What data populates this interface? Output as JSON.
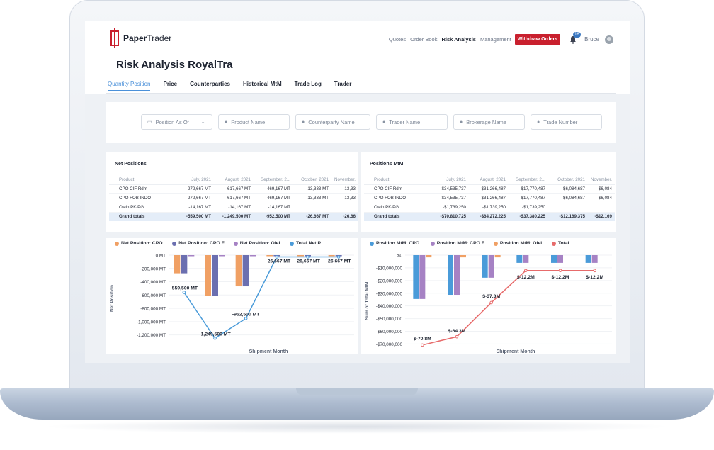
{
  "app": {
    "logo_bold": "Paper",
    "logo_rest": "Trader"
  },
  "nav": {
    "items": [
      "Quotes",
      "Order Book",
      "Risk Analysis",
      "Management"
    ],
    "active": "Risk Analysis",
    "withdraw": "Withdraw Orders",
    "notifications": "16",
    "user": "Bruce"
  },
  "page": {
    "title": "Risk Analysis RoyalTra"
  },
  "tabs": [
    "Quantity Position",
    "Price",
    "Counterparties",
    "Historical MtM",
    "Trade Log",
    "Trader"
  ],
  "filters": {
    "position_as_of": "Position As Of",
    "product": "Product Name",
    "counterparty": "Counterparty Name",
    "trader": "Trader Name",
    "brokerage": "Brokerage Name",
    "trade_number": "Trade Number"
  },
  "net_positions": {
    "title": "Net Positions",
    "columns": [
      "Product",
      "July, 2021",
      "August, 2021",
      "September, 2...",
      "October, 2021",
      "November,"
    ],
    "rows": [
      [
        "CPO CIF Rdm",
        "-272,667 MT",
        "-617,667 MT",
        "-469,167 MT",
        "-13,333 MT",
        "-13,33"
      ],
      [
        "CPO FOB INDO",
        "-272,667 MT",
        "-617,667 MT",
        "-469,167 MT",
        "-13,333 MT",
        "-13,33"
      ],
      [
        "Olein PK/PG",
        "-14,167 MT",
        "-14,167 MT",
        "-14,167 MT",
        "",
        ""
      ]
    ],
    "total": [
      "Grand totals",
      "-559,500 MT",
      "-1,249,500 MT",
      "-952,500 MT",
      "-26,667 MT",
      "-26,66"
    ]
  },
  "positions_mtm": {
    "title": "Positions MtM",
    "columns": [
      "Product",
      "July, 2021",
      "August, 2021",
      "September, 2...",
      "October, 2021",
      "November,"
    ],
    "rows": [
      [
        "CPO CIF Rdm",
        "-$34,535,737",
        "-$31,266,487",
        "-$17,770,487",
        "-$6,084,687",
        "-$6,084"
      ],
      [
        "CPO FOB INDO",
        "-$34,535,737",
        "-$31,266,487",
        "-$17,770,487",
        "-$6,084,687",
        "-$6,084"
      ],
      [
        "Olein PK/PG",
        "-$1,739,250",
        "-$1,739,250",
        "-$1,739,250",
        "",
        ""
      ]
    ],
    "total": [
      "Grand totals",
      "-$70,810,725",
      "-$64,272,225",
      "-$37,380,225",
      "-$12,169,375",
      "-$12,169"
    ]
  },
  "chart_data": [
    {
      "type": "bar",
      "legend": [
        "Net Position: CPO...",
        "Net Position: CPO F...",
        "Net Position: Olei...",
        "Total Net P..."
      ],
      "ylabel": "Net Position",
      "xlabel": "Shipment Month",
      "yticks": [
        "0 MT",
        "-200,000 MT",
        "-400,000 MT",
        "-600,000 MT",
        "-800,000 MT",
        "-1,000,000 MT",
        "-1,200,000 MT"
      ],
      "ylim": [
        -1300000,
        0
      ],
      "series": [
        {
          "name": "Net Position: CPO...",
          "color": "#f0a064",
          "values": [
            -272667,
            -617667,
            -469167,
            -13333,
            -13333,
            -13333
          ]
        },
        {
          "name": "Net Position: CPO F...",
          "color": "#6b6fb0",
          "values": [
            -272667,
            -617667,
            -469167,
            -13333,
            -13333,
            -13333
          ]
        },
        {
          "name": "Net Position: Olei...",
          "color": "#a682c4",
          "values": [
            -14167,
            -14167,
            -14167,
            0,
            0,
            0
          ]
        },
        {
          "name": "Total Net P...",
          "color": "#4a9bd9",
          "values": [
            -559500,
            -1249500,
            -952500,
            -26667,
            -26667,
            -26667
          ]
        }
      ],
      "labels": [
        "-559,500 MT",
        "-1,249,500 MT",
        "-952,500 MT",
        "-26,667 MT",
        "-26,667 MT",
        "-26,667 MT"
      ]
    },
    {
      "type": "bar",
      "legend": [
        "Position MtM: CPO ...",
        "Position MtM: CPO F...",
        "Position MtM: Olei...",
        "Total ..."
      ],
      "ylabel": "Sum of Total MtM",
      "xlabel": "Shipment Month",
      "yticks": [
        "$0",
        "-$10,000,000",
        "-$20,000,000",
        "-$30,000,000",
        "-$40,000,000",
        "-$50,000,000",
        "-$60,000,000",
        "-$70,000,000"
      ],
      "ylim": [
        -72000000,
        0
      ],
      "series": [
        {
          "name": "Position MtM: CPO ...",
          "color": "#4a9bd9",
          "values": [
            -34535737,
            -31266487,
            -17770487,
            -6084687,
            -6084687,
            -6084687
          ]
        },
        {
          "name": "Position MtM: CPO F...",
          "color": "#a682c4",
          "values": [
            -34535737,
            -31266487,
            -17770487,
            -6084687,
            -6084687,
            -6084687
          ]
        },
        {
          "name": "Position MtM: Olei...",
          "color": "#f0a064",
          "values": [
            -1739250,
            -1739250,
            -1739250,
            0,
            0,
            0
          ]
        },
        {
          "name": "Total ...",
          "color": "#e76b6b",
          "values": [
            -70810725,
            -64272225,
            -37380225,
            -12169375,
            -12169375,
            -12169375
          ]
        }
      ],
      "labels": [
        "$-70.8M",
        "$-64.3M",
        "$-37.3M",
        "$-12.2M",
        "$-12.2M",
        "$-12.2M"
      ]
    }
  ]
}
